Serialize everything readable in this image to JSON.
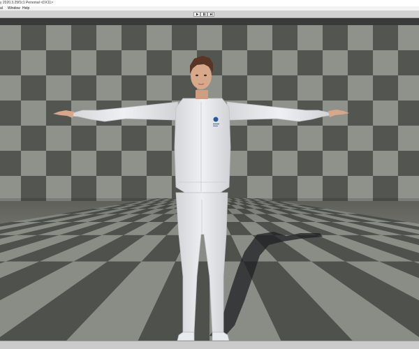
{
  "window": {
    "title": "y 2020.3.25f1c1 Personal <DX11>"
  },
  "menu": {
    "items": [
      {
        "label": "al"
      },
      {
        "label": "Window"
      },
      {
        "label": "Help"
      }
    ]
  },
  "toolbar": {
    "buttons": [
      {
        "name": "play-button",
        "icon": "play-icon"
      },
      {
        "name": "pause-button",
        "icon": "pause-icon"
      },
      {
        "name": "step-button",
        "icon": "step-icon"
      }
    ]
  },
  "scene": {
    "floor_light": "#8a8c86",
    "floor_dark": "#4f514c",
    "wall_light": "#8f918b",
    "wall_dark": "#525550",
    "background": "#6e6f68"
  },
  "character": {
    "shirt_color": "#e6e8ec",
    "pants_color": "#e1e3e7",
    "skin_color": "#d8a88a",
    "hair_color": "#5a3525",
    "logo_color": "#2a5a9a"
  }
}
